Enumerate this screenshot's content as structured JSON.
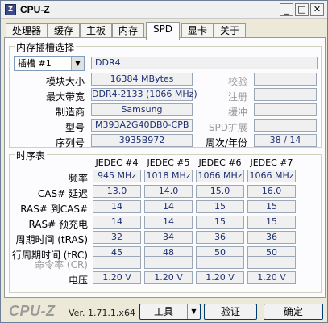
{
  "window": {
    "title": "CPU-Z",
    "icon_text": "Z",
    "min": "_",
    "max": "□",
    "close": "✕"
  },
  "tabs": [
    "处理器",
    "缓存",
    "主板",
    "内存",
    "SPD",
    "显卡",
    "关于"
  ],
  "active_tab": "SPD",
  "slot_group": {
    "title": "内存插槽选择",
    "slot_select": "插槽 #1",
    "memory_type": "DDR4",
    "module_size_label": "模块大小",
    "module_size": "16384 MBytes",
    "max_bandwidth_label": "最大带宽",
    "max_bandwidth": "DDR4-2133 (1066 MHz)",
    "manufacturer_label": "制造商",
    "manufacturer": "Samsung",
    "part_number_label": "型号",
    "part_number": "M393A2G40DB0-CPB",
    "serial_label": "序列号",
    "serial": "3935B972",
    "correction_label": "校验",
    "registered_label": "注册",
    "buffered_label": "缓冲",
    "spd_ext_label": "SPD扩展",
    "week_year_label": "周次/年份",
    "week_year": "38 / 14"
  },
  "timing_group": {
    "title": "时序表",
    "columns": [
      "JEDEC #4",
      "JEDEC #5",
      "JEDEC #6",
      "JEDEC #7"
    ],
    "rows": [
      {
        "label": "频率",
        "values": [
          "945 MHz",
          "1018 MHz",
          "1066 MHz",
          "1066 MHz"
        ],
        "dim": false
      },
      {
        "label": "CAS# 延迟",
        "values": [
          "13.0",
          "14.0",
          "15.0",
          "16.0"
        ],
        "dim": false
      },
      {
        "label": "RAS# 到CAS#",
        "values": [
          "14",
          "14",
          "15",
          "15"
        ],
        "dim": false
      },
      {
        "label": "RAS# 预充电",
        "values": [
          "14",
          "14",
          "15",
          "15"
        ],
        "dim": false
      },
      {
        "label": "周期时间 (tRAS)",
        "values": [
          "32",
          "34",
          "36",
          "36"
        ],
        "dim": false
      },
      {
        "label": "行周期时间 (tRC)",
        "values": [
          "45",
          "48",
          "50",
          "50"
        ],
        "dim": false
      },
      {
        "label": "命令率 (CR)",
        "values": [
          "",
          "",
          "",
          ""
        ],
        "dim": true
      },
      {
        "label": "电压",
        "values": [
          "1.20 V",
          "1.20 V",
          "1.20 V",
          "1.20 V"
        ],
        "dim": false
      }
    ]
  },
  "footer": {
    "logo": "CPU-Z",
    "version": "Ver. 1.71.1.x64",
    "tools_label": "工具",
    "verify_label": "验证",
    "ok_label": "确定"
  }
}
